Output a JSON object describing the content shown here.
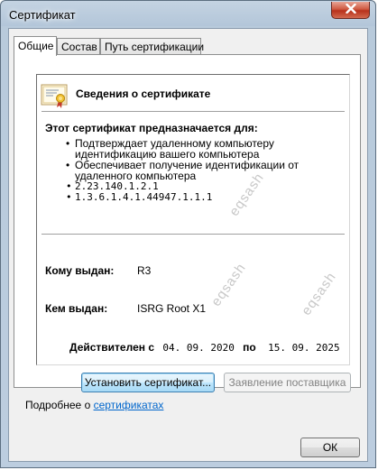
{
  "window": {
    "title": "Сертификат"
  },
  "tabs": [
    {
      "label": "Общие"
    },
    {
      "label": "Состав"
    },
    {
      "label": "Путь сертификации"
    }
  ],
  "info": {
    "header": "Сведения о сертификате",
    "purpose_title": "Этот сертификат предназначается для:",
    "purposes": [
      "Подтверждает удаленному компьютеру идентификацию вашего компьютера",
      "Обеспечивает получение идентификации от удаленного компьютера",
      "2.23.140.1.2.1",
      "1.3.6.1.4.1.44947.1.1.1"
    ],
    "issued_to_label": "Кому выдан:",
    "issued_to_value": "R3",
    "issued_by_label": "Кем выдан:",
    "issued_by_value": "ISRG Root X1",
    "valid_from_label": "Действителен с",
    "valid_from": "04. 09. 2020",
    "valid_to_label": "по",
    "valid_to": "15. 09. 2025",
    "watermark_text": "eqsash"
  },
  "buttons": {
    "install": "Установить сертификат...",
    "issuer_statement": "Заявление поставщика",
    "ok": "ОК"
  },
  "footer": {
    "more_prefix": "Подробнее о ",
    "more_link": "сертификатах"
  }
}
